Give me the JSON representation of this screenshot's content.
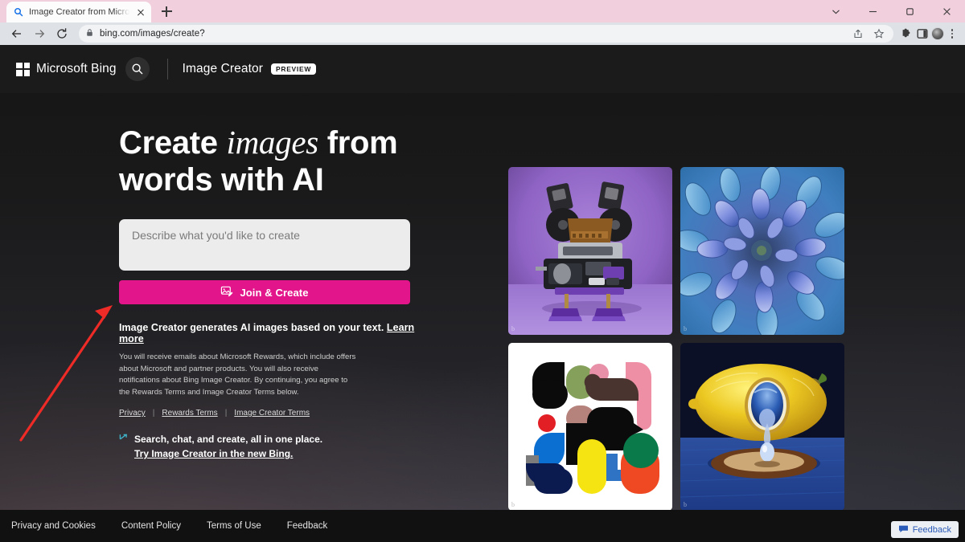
{
  "browser": {
    "tab": {
      "title": "Image Creator from Microsoft Bi",
      "favicon": "bing-search-icon",
      "close": "close-icon"
    },
    "newtab_label": "new-tab-icon",
    "window_controls": [
      "tab-search-chevron-icon",
      "minimize-icon",
      "maximize-icon",
      "close-window-icon"
    ],
    "nav": {
      "back": "back-arrow-icon",
      "forward": "forward-arrow-icon",
      "reload": "reload-icon"
    },
    "omnibox": {
      "lock": "lock-icon",
      "url": "bing.com/images/create?",
      "share": "share-icon",
      "bookmark": "star-icon"
    },
    "toolbar_right": [
      "extensions-puzzle-icon",
      "side-panel-icon",
      "profile-avatar",
      "chrome-menu-icon"
    ]
  },
  "topnav": {
    "logo_word": "Microsoft Bing",
    "search_icon": "search-icon",
    "product": "Image Creator",
    "badge": "PREVIEW"
  },
  "hero": {
    "line1_a": "Create ",
    "line1_italic": "images",
    "line1_b": " from",
    "line2": "words with AI"
  },
  "prompt": {
    "placeholder": "Describe what you'd like to create",
    "value": ""
  },
  "cta": {
    "label": "Join & Create",
    "icon": "image-edit-icon",
    "color": "#e3158a"
  },
  "disclaimer": {
    "headline": "Image Creator generates AI images based on your text. ",
    "learn_more": "Learn more",
    "body": "You will receive emails about Microsoft Rewards, which include offers about Microsoft and partner products. You will also receive notifications about Bing Image Creator. By continuing, you agree to the Rewards Terms and Image Creator Terms below."
  },
  "legal_links": [
    {
      "label": "Privacy"
    },
    {
      "label": "Rewards Terms"
    },
    {
      "label": "Image Creator Terms"
    }
  ],
  "promo": {
    "icon": "bing-chat-icon",
    "line1": "Search, chat, and create, all in one place.",
    "link": "Try Image Creator in the new Bing."
  },
  "gallery": [
    {
      "name": "sample-image-robot",
      "alt": "purple robot sculpture",
      "watermark": "b"
    },
    {
      "name": "sample-image-flower",
      "alt": "blue dahlia flower close-up",
      "watermark": "b"
    },
    {
      "name": "sample-image-abstract",
      "alt": "abstract colored shapes on white",
      "watermark": "b"
    },
    {
      "name": "sample-image-lemon",
      "alt": "surreal lemon with water droplet",
      "watermark": "b"
    }
  ],
  "footer": {
    "links": [
      "Privacy and Cookies",
      "Content Policy",
      "Terms of Use",
      "Feedback"
    ],
    "feedback_button": {
      "label": "Feedback",
      "icon": "speech-bubble-icon"
    }
  },
  "annotation": {
    "type": "red-arrow",
    "color": "#ee2b26",
    "points_to": "join-create-button"
  }
}
